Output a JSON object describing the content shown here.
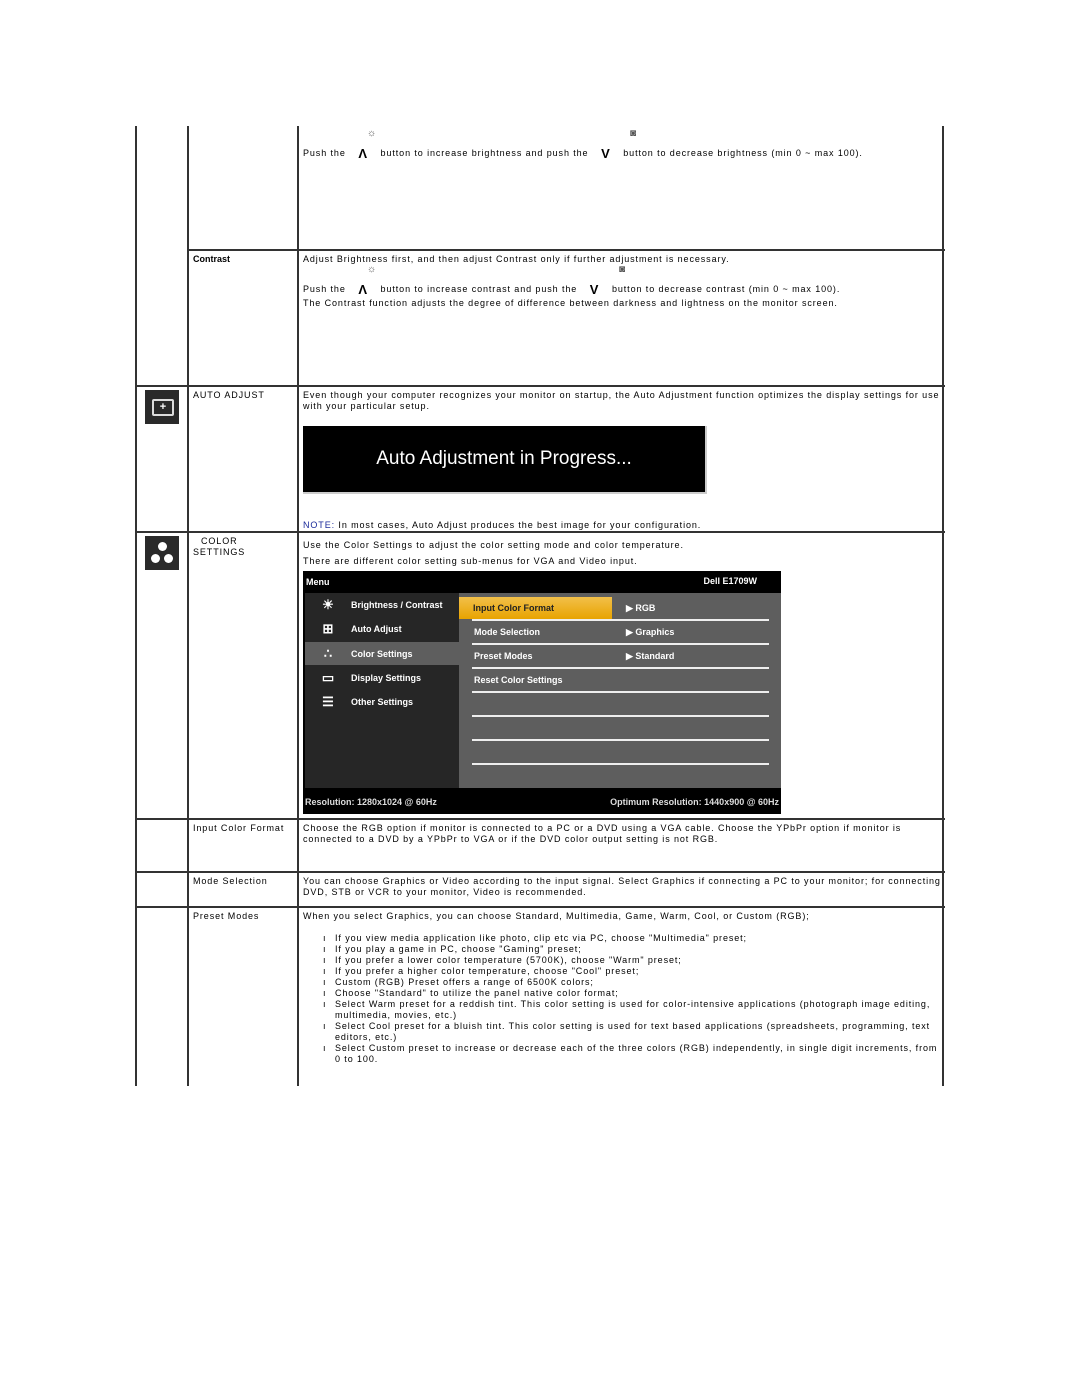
{
  "brightness": {
    "text_before": "Push the",
    "text_middle": "button to increase brightness and push the",
    "text_after": "button to decrease brightness (min 0 ~ max 100).",
    "up_arrow": "Λ",
    "down_arrow": "V"
  },
  "contrast": {
    "label": "Contrast",
    "intro": "Adjust Brightness first, and then adjust Contrast only if further adjustment is necessary.",
    "text_before": "Push the",
    "text_middle": "button to increase contrast and push the",
    "text_after": "button to decrease contrast (min 0 ~ max 100).",
    "description": "The Contrast function adjusts the degree of difference between darkness and lightness on the monitor screen.",
    "up_arrow": "Λ",
    "down_arrow": "V"
  },
  "auto_adjust": {
    "label": "AUTO ADJUST",
    "icon": "auto-adjust-icon",
    "description": "Even though your computer recognizes your monitor on startup, the Auto Adjustment function optimizes the display settings for use with your particular setup.",
    "banner": "Auto Adjustment in Progress...",
    "note_keyword": "NOTE:",
    "note_text": " In most cases, Auto Adjust produces the best image for your configuration."
  },
  "color_settings": {
    "label_line1": "COLOR",
    "label_line2": "SETTINGS",
    "icon": "color-settings-icon",
    "line1": "Use the Color Settings to adjust the color setting mode and color temperature.",
    "line2": "There are different color setting sub-menus for VGA and Video input."
  },
  "osd": {
    "title": "Menu",
    "model": "Dell E1709W",
    "main_items": [
      {
        "label": "Brightness / Contrast",
        "icon": "☀"
      },
      {
        "label": "Auto Adjust",
        "icon": "⊞"
      },
      {
        "label": "Color Settings",
        "icon": "∴"
      },
      {
        "label": "Display Settings",
        "icon": "▭"
      },
      {
        "label": "Other Settings",
        "icon": "☰"
      }
    ],
    "active_index": 2,
    "sub_items": [
      {
        "label": "Input Color Format",
        "value": "▶ RGB"
      },
      {
        "label": "Mode Selection",
        "value": "▶ Graphics"
      },
      {
        "label": "Preset Modes",
        "value": "▶ Standard"
      },
      {
        "label": "Reset Color Settings",
        "value": ""
      }
    ],
    "resolution": "Resolution: 1280x1024 @ 60Hz",
    "optimum": "Optimum Resolution: 1440x900 @ 60Hz"
  },
  "input_color_format": {
    "label": "Input Color Format",
    "text": "Choose the RGB option if monitor is connected to a PC or a DVD using a VGA cable. Choose the YPbPr option if monitor is connected to a DVD by a YPbPr to VGA or if the DVD color output setting is not RGB."
  },
  "mode_selection": {
    "label": "Mode Selection",
    "text": "You can choose Graphics or Video according to the input signal. Select Graphics if connecting a PC to your monitor; for connecting DVD, STB or VCR to your monitor, Video is recommended."
  },
  "preset_modes": {
    "label": "Preset Modes",
    "intro": "When you select Graphics, you can choose Standard, Multimedia, Game, Warm, Cool, or Custom (RGB);",
    "bullets": [
      "If you view media application like photo, clip etc via PC, choose \"Multimedia\" preset;",
      "If you play a game in PC, choose \"Gaming\" preset;",
      "If you prefer a lower color temperature (5700K), choose \"Warm\" preset;",
      "If you prefer a higher color temperature, choose \"Cool\" preset;",
      "Custom (RGB) Preset offers a range of 6500K colors;",
      "Choose \"Standard\" to utilize the panel native color format;",
      "Select Warm preset for a reddish tint. This color setting is used for color-intensive applications (photograph image editing, multimedia, movies, etc.)",
      "Select Cool preset for a bluish tint. This color setting is used for text based applications (spreadsheets, programming, text editors, etc.)",
      "Select Custom preset to increase or decrease each of the three colors (RGB) independently, in single digit increments, from 0 to 100."
    ]
  }
}
